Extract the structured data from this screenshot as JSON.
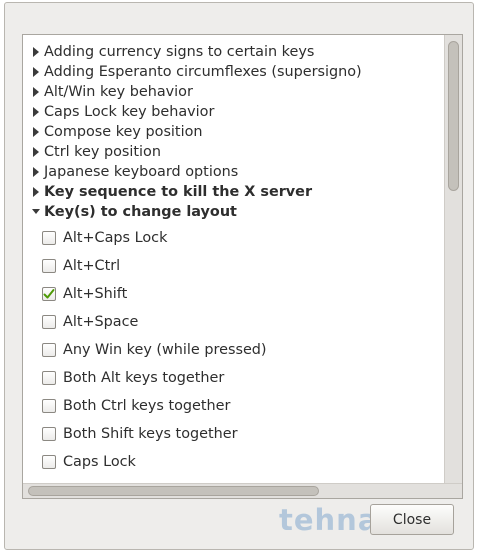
{
  "groups": [
    {
      "label": "Adding currency signs to certain keys",
      "expanded": false,
      "bold": false
    },
    {
      "label": "Adding Esperanto circumflexes (supersigno)",
      "expanded": false,
      "bold": false
    },
    {
      "label": "Alt/Win key behavior",
      "expanded": false,
      "bold": false
    },
    {
      "label": "Caps Lock key behavior",
      "expanded": false,
      "bold": false
    },
    {
      "label": "Compose key position",
      "expanded": false,
      "bold": false
    },
    {
      "label": "Ctrl key position",
      "expanded": false,
      "bold": false
    },
    {
      "label": "Japanese keyboard options",
      "expanded": false,
      "bold": false
    },
    {
      "label": "Key sequence to kill the X server",
      "expanded": false,
      "bold": true
    },
    {
      "label": "Key(s) to change layout",
      "expanded": true,
      "bold": true
    }
  ],
  "options": [
    {
      "label": "Alt+Caps Lock",
      "checked": false
    },
    {
      "label": "Alt+Ctrl",
      "checked": false
    },
    {
      "label": "Alt+Shift",
      "checked": true
    },
    {
      "label": "Alt+Space",
      "checked": false
    },
    {
      "label": "Any Win key (while pressed)",
      "checked": false
    },
    {
      "label": "Both Alt keys together",
      "checked": false
    },
    {
      "label": "Both Ctrl keys together",
      "checked": false
    },
    {
      "label": "Both Shift keys together",
      "checked": false
    },
    {
      "label": "Caps Lock",
      "checked": false
    }
  ],
  "close_label": "Close",
  "watermark": "tehnari.ru",
  "colors": {
    "window_bg": "#eeedeb",
    "check_mark": "#4e9a06",
    "text": "#2e2e2e"
  },
  "icons": {
    "collapsed": "triangle-right-icon",
    "expanded": "triangle-down-icon",
    "checked": "checkmark-icon"
  }
}
